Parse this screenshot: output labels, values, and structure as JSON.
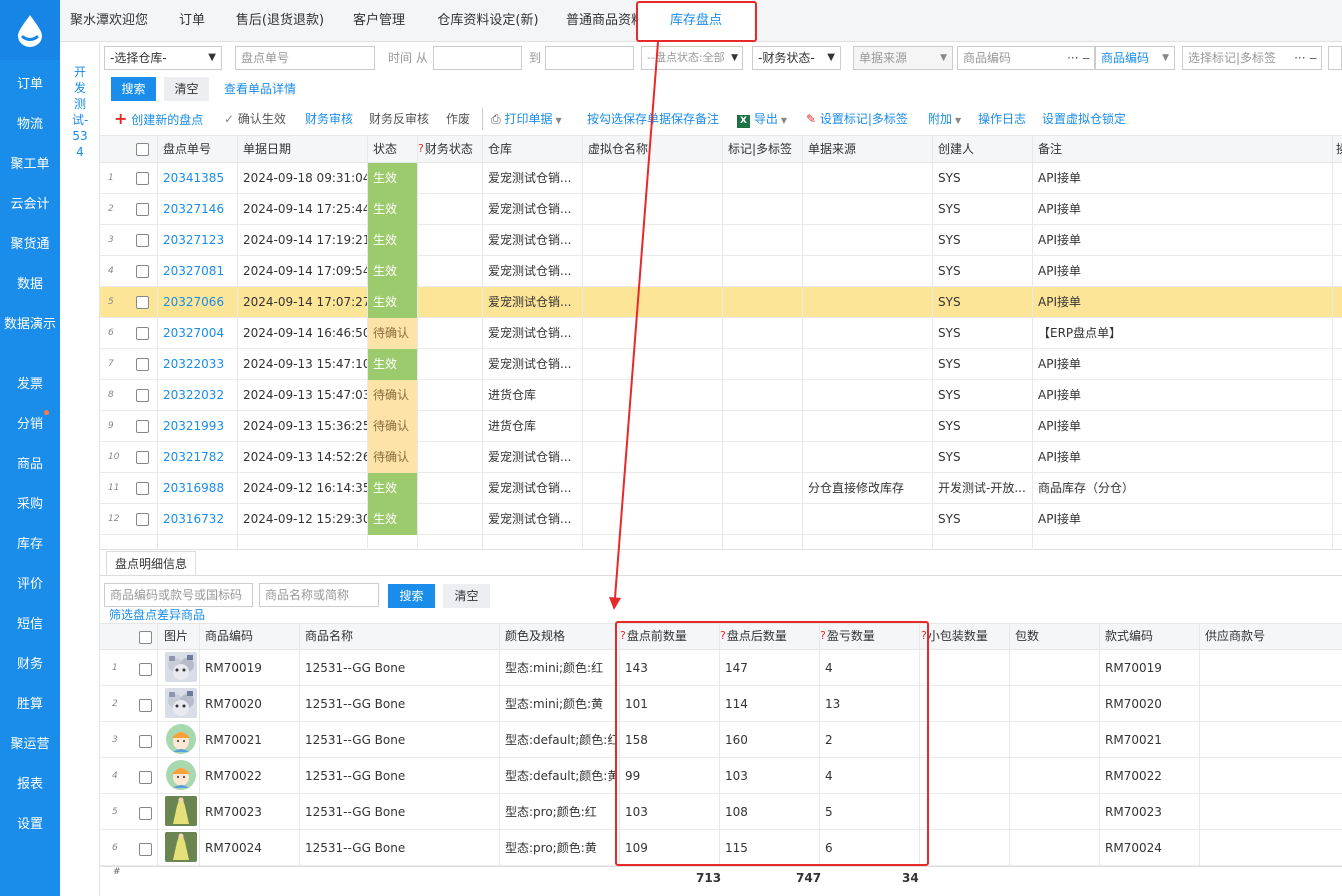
{
  "sidebar": {
    "items": [
      "订单",
      "物流",
      "聚工单",
      "云会计",
      "聚货通",
      "数据",
      "数据演示",
      "发票",
      "分销",
      "商品",
      "采购",
      "库存",
      "评价",
      "短信",
      "财务",
      "胜算",
      "聚运营",
      "报表",
      "设置"
    ]
  },
  "side_strip": {
    "text": "开发测试-534"
  },
  "tabs": [
    "聚水潭欢迎您",
    "订单",
    "售后(退货退款)",
    "客户管理",
    "仓库资料设定(新)",
    "普通商品资料",
    "库存盘点"
  ],
  "filters": {
    "warehouse": "-选择仓库-",
    "check_no_placeholder": "盘点单号",
    "time_from_label": "时间 从",
    "time_to_label": "到",
    "check_status": "--盘点状态:全部",
    "finance_status": "-财务状态-",
    "source": "单据来源",
    "product_code_placeholder": "商品编码",
    "product_code_select": "商品编码",
    "tag_placeholder": "选择标记|多标签",
    "search": "搜索",
    "clear": "清空",
    "view_detail": "查看单品详情"
  },
  "toolbar": {
    "create": "创建新的盘点",
    "confirm": "确认生效",
    "fin_audit": "财务审核",
    "fin_unaudit": "财务反审核",
    "void": "作废",
    "print": "打印单据",
    "save_remark": "按勾选保存单据保存备注",
    "export": "导出",
    "set_tag": "设置标记|多标签",
    "extra": "附加",
    "log": "操作日志",
    "lock": "设置虚拟仓锁定"
  },
  "main_table": {
    "headers": [
      "盘点单号",
      "单据日期",
      "状态",
      "财务状态",
      "仓库",
      "虚拟仓名称",
      "标记|多标签",
      "单据来源",
      "创建人",
      "备注",
      "操"
    ],
    "rows": [
      {
        "n": "1",
        "id": "20341385",
        "date": "2024-09-18 09:31:04",
        "status": "生效",
        "wh": "爱宠测试仓销...",
        "src": "",
        "creator": "SYS",
        "remark": "API接单"
      },
      {
        "n": "2",
        "id": "20327146",
        "date": "2024-09-14 17:25:44",
        "status": "生效",
        "wh": "爱宠测试仓销...",
        "src": "",
        "creator": "SYS",
        "remark": "API接单"
      },
      {
        "n": "3",
        "id": "20327123",
        "date": "2024-09-14 17:19:21",
        "status": "生效",
        "wh": "爱宠测试仓销...",
        "src": "",
        "creator": "SYS",
        "remark": "API接单"
      },
      {
        "n": "4",
        "id": "20327081",
        "date": "2024-09-14 17:09:54",
        "status": "生效",
        "wh": "爱宠测试仓销...",
        "src": "",
        "creator": "SYS",
        "remark": "API接单"
      },
      {
        "n": "5",
        "id": "20327066",
        "date": "2024-09-14 17:07:27",
        "status": "生效",
        "wh": "爱宠测试仓销...",
        "src": "",
        "creator": "SYS",
        "remark": "API接单"
      },
      {
        "n": "6",
        "id": "20327004",
        "date": "2024-09-14 16:46:50",
        "status": "待确认",
        "wh": "爱宠测试仓销...",
        "src": "",
        "creator": "SYS",
        "remark": "【ERP盘点单】"
      },
      {
        "n": "7",
        "id": "20322033",
        "date": "2024-09-13 15:47:10",
        "status": "生效",
        "wh": "爱宠测试仓销...",
        "src": "",
        "creator": "SYS",
        "remark": "API接单"
      },
      {
        "n": "8",
        "id": "20322032",
        "date": "2024-09-13 15:47:03",
        "status": "待确认",
        "wh": "进货仓库",
        "src": "",
        "creator": "SYS",
        "remark": "API接单"
      },
      {
        "n": "9",
        "id": "20321993",
        "date": "2024-09-13 15:36:25",
        "status": "待确认",
        "wh": "进货仓库",
        "src": "",
        "creator": "SYS",
        "remark": "API接单"
      },
      {
        "n": "10",
        "id": "20321782",
        "date": "2024-09-13 14:52:26",
        "status": "待确认",
        "wh": "爱宠测试仓销...",
        "src": "",
        "creator": "SYS",
        "remark": "API接单"
      },
      {
        "n": "11",
        "id": "20316988",
        "date": "2024-09-12 16:14:35",
        "status": "生效",
        "wh": "爱宠测试仓销...",
        "src": "分仓直接修改库存",
        "creator": "开发测试-开放...",
        "remark": "商品库存（分仓）"
      },
      {
        "n": "12",
        "id": "20316732",
        "date": "2024-09-12 15:29:30",
        "status": "生效",
        "wh": "爱宠测试仓销...",
        "src": "",
        "creator": "SYS",
        "remark": "API接单"
      }
    ]
  },
  "detail": {
    "tab": "盘点明细信息",
    "code_placeholder": "商品编码或款号或国标码",
    "name_placeholder": "商品名称或简称",
    "search": "搜索",
    "clear": "清空",
    "filter_link": "筛选盘点差异商品",
    "headers": [
      "图片",
      "商品编码",
      "商品名称",
      "颜色及规格",
      "盘点前数量",
      "盘点后数量",
      "盈亏数量",
      "小包装数量",
      "包数",
      "款式编码",
      "供应商款号"
    ],
    "rows": [
      {
        "n": "1",
        "code": "RM70019",
        "name": "12531--GG Bone",
        "spec": "型态:mini;颜色:红",
        "before": "143",
        "after": "147",
        "diff": "4",
        "style": "RM70019",
        "img": "dog"
      },
      {
        "n": "2",
        "code": "RM70020",
        "name": "12531--GG Bone",
        "spec": "型态:mini;颜色:黄",
        "before": "101",
        "after": "114",
        "diff": "13",
        "style": "RM70020",
        "img": "dog"
      },
      {
        "n": "3",
        "code": "RM70021",
        "name": "12531--GG Bone",
        "spec": "型态:default;颜色:红",
        "before": "158",
        "after": "160",
        "diff": "2",
        "style": "RM70021",
        "img": "face"
      },
      {
        "n": "4",
        "code": "RM70022",
        "name": "12531--GG Bone",
        "spec": "型态:default;颜色:黄",
        "before": "99",
        "after": "103",
        "diff": "4",
        "style": "RM70022",
        "img": "face"
      },
      {
        "n": "5",
        "code": "RM70023",
        "name": "12531--GG Bone",
        "spec": "型态:pro;颜色:红",
        "before": "103",
        "after": "108",
        "diff": "5",
        "style": "RM70023",
        "img": "dress"
      },
      {
        "n": "6",
        "code": "RM70024",
        "name": "12531--GG Bone",
        "spec": "型态:pro;颜色:黄",
        "before": "109",
        "after": "115",
        "diff": "6",
        "style": "RM70024",
        "img": "dress"
      }
    ],
    "footer": {
      "hash": "#",
      "before": "713",
      "after": "747",
      "diff": "34"
    }
  },
  "colors": {
    "accent": "#1a8cea",
    "effective": "#9bcb6c",
    "pending": "#fde3a8",
    "highlight": "#fde598",
    "red": "#e8292a"
  }
}
